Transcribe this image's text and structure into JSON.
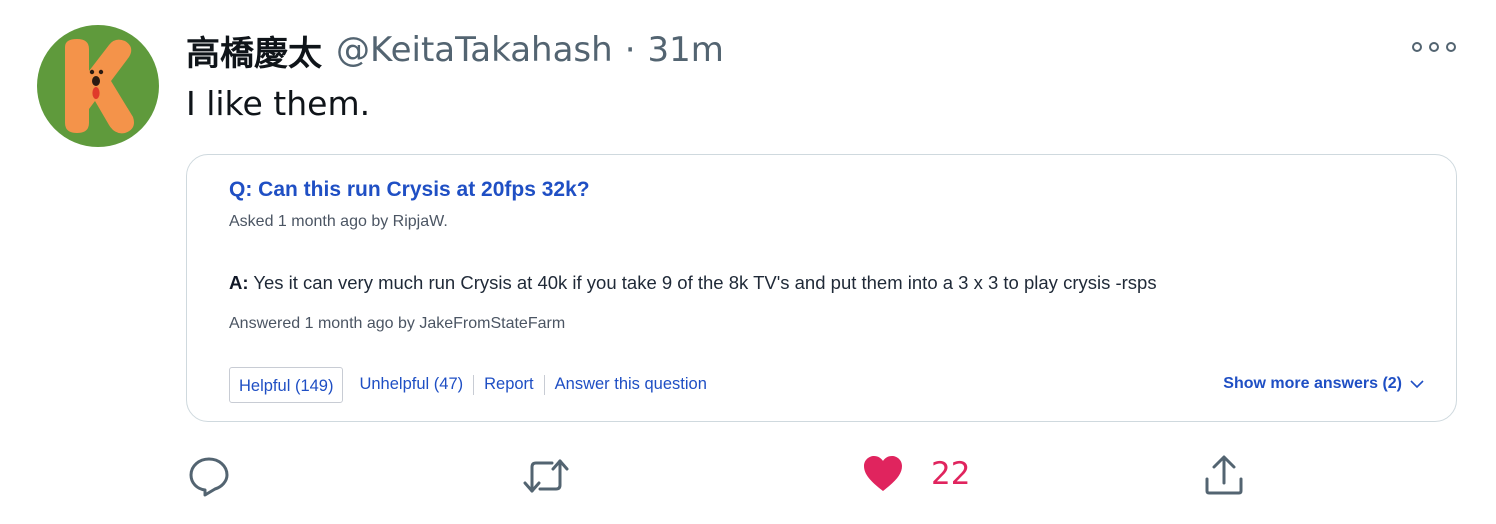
{
  "tweet": {
    "display_name": "高橋慶太",
    "handle": "@KeitaTakahash",
    "separator": "·",
    "time": "31m",
    "text": "I like them.",
    "avatar_icon": "k-letter-avatar",
    "avatar_bg": "#5f9a3c",
    "avatar_letter_color": "#f4934a"
  },
  "card": {
    "question": "Q: Can this run Crysis at 20fps 32k?",
    "asked": "Asked 1 month ago by RipjaW.",
    "answer_prefix": "A:",
    "answer_text": " Yes it can very much run Crysis at 40k if you take 9 of the 8k TV's and put them into a 3 x 3 to play crysis -rsps",
    "answered": "Answered 1 month ago by JakeFromStateFarm",
    "helpful": "Helpful (149)",
    "unhelpful": "Unhelpful (47)",
    "report": "Report",
    "answer_question": "Answer this question",
    "show_more": "Show more answers (2)",
    "accent": "#1f4fc4"
  },
  "actions": {
    "reply_icon": "reply-icon",
    "retweet_icon": "retweet-icon",
    "like_icon": "heart-icon",
    "like_count": "22",
    "like_color": "#e0245e",
    "share_icon": "share-icon"
  }
}
